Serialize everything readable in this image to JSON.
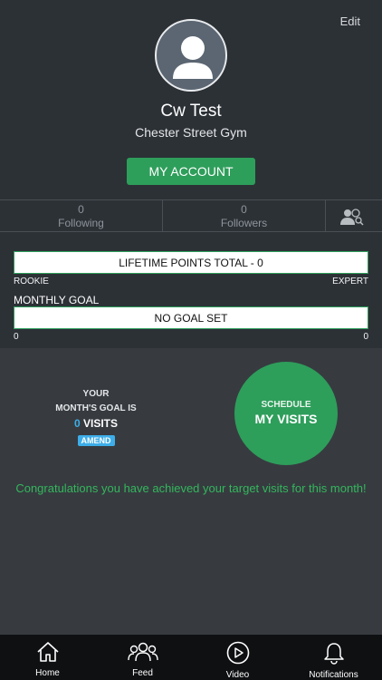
{
  "header": {
    "edit_label": "Edit",
    "name": "Cw Test",
    "gym": "Chester Street Gym",
    "account_button": "MY ACCOUNT"
  },
  "follow": {
    "following_count": "0",
    "following_label": "Following",
    "followers_count": "0",
    "followers_label": "Followers"
  },
  "points": {
    "lifetime_label": "LIFETIME POINTS TOTAL - 0",
    "rookie": "ROOKIE",
    "expert": "EXPERT",
    "monthly_goal_label": "MONTHLY GOAL",
    "goal_status": "NO GOAL SET",
    "goal_min": "0",
    "goal_max": "0"
  },
  "goal": {
    "line1": "YOUR",
    "line2": "MONTH'S GOAL IS",
    "visits_count": "0",
    "visits_word": "VISITS",
    "amend": "AMEND"
  },
  "schedule": {
    "line1": "SCHEDULE",
    "line2": "MY VISITS"
  },
  "message": "Congratulations you have achieved your target visits for this month!",
  "tabs": [
    {
      "label": "Home",
      "icon": "home-icon"
    },
    {
      "label": "Feed",
      "icon": "group-icon"
    },
    {
      "label": "Video",
      "icon": "play-icon"
    },
    {
      "label": "Notifications",
      "icon": "bell-icon"
    }
  ],
  "colors": {
    "accent_green": "#2e9e5b",
    "accent_blue": "#3daee9",
    "background": "#373b40",
    "header": "#2c3136"
  }
}
